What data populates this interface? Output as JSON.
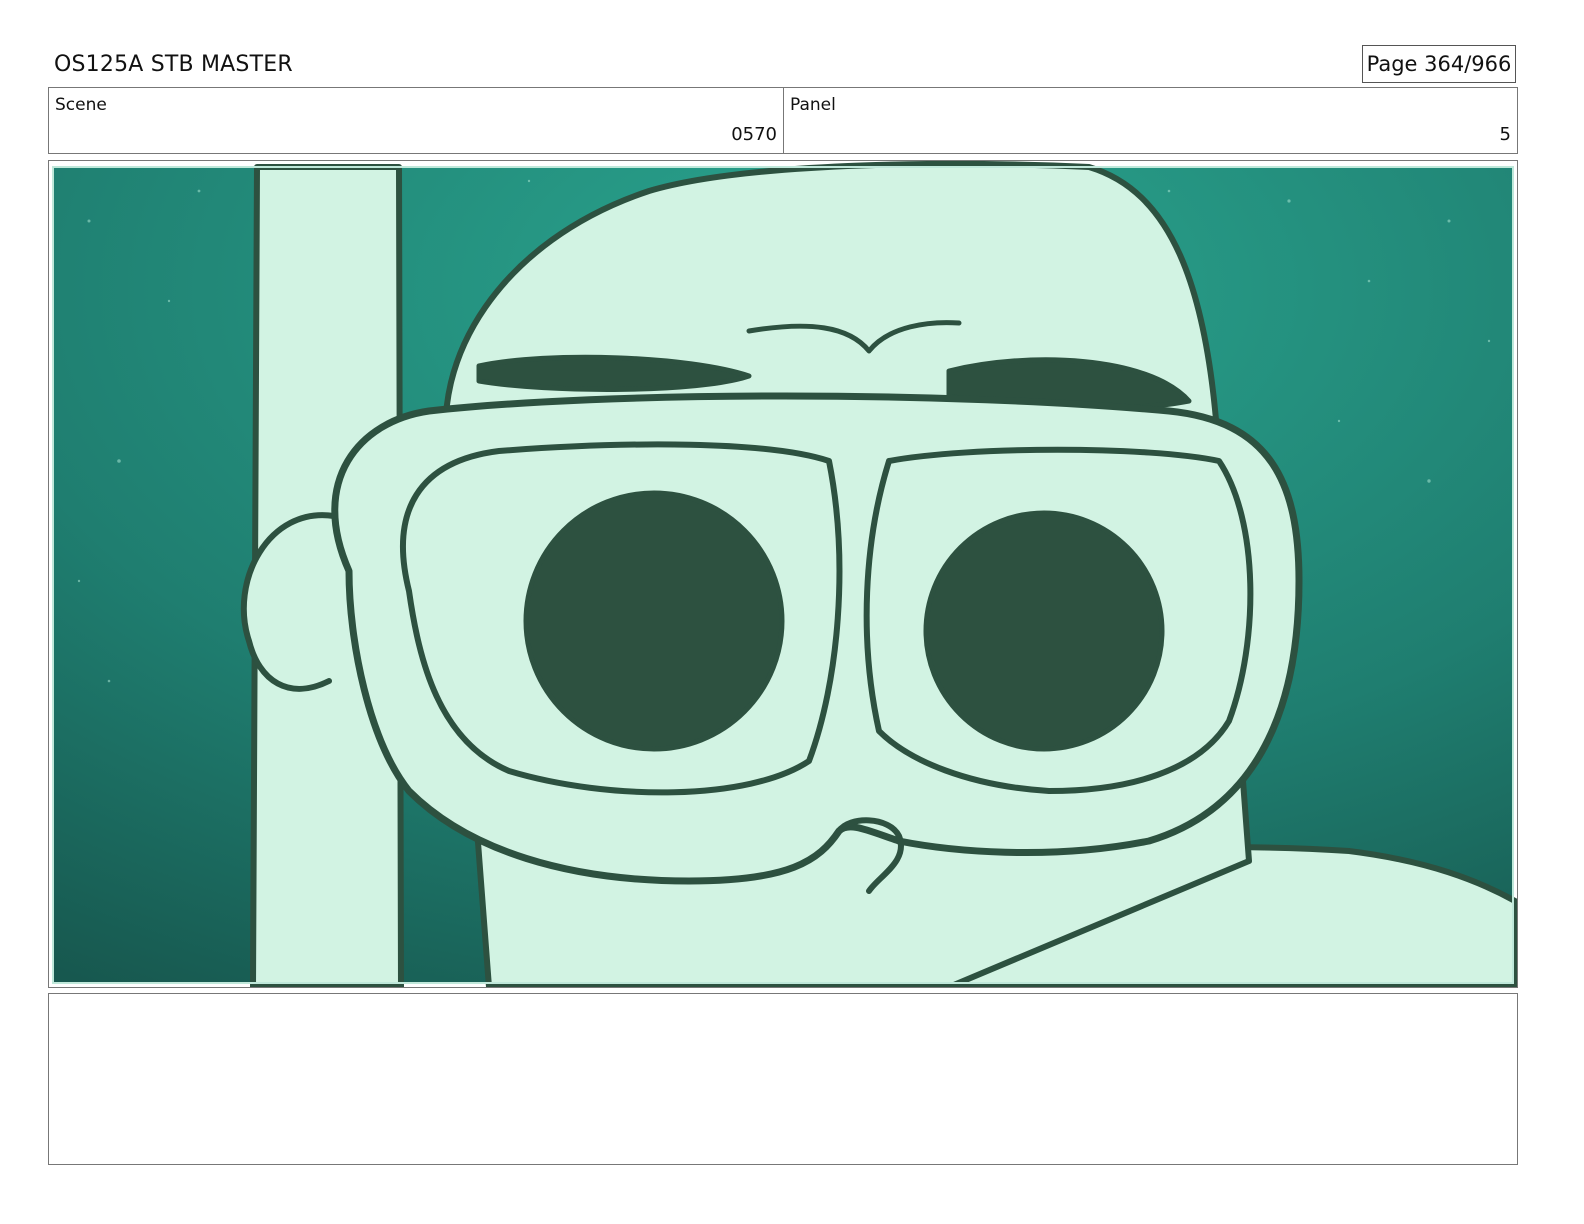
{
  "header": {
    "title": "OS125A  STB MASTER",
    "page_label": "Page 364/966"
  },
  "info": {
    "scene_label": "Scene",
    "scene_value": "0570",
    "panel_label": "Panel",
    "panel_value": "5"
  },
  "frame": {
    "description_icon": "storyboard-sketch-diver-goggles",
    "colors": {
      "water_light": "#2aa58f",
      "water_dark": "#17584f",
      "skin": "#d2f3e3",
      "line": "#2d5140"
    }
  },
  "notes": {
    "text": ""
  }
}
